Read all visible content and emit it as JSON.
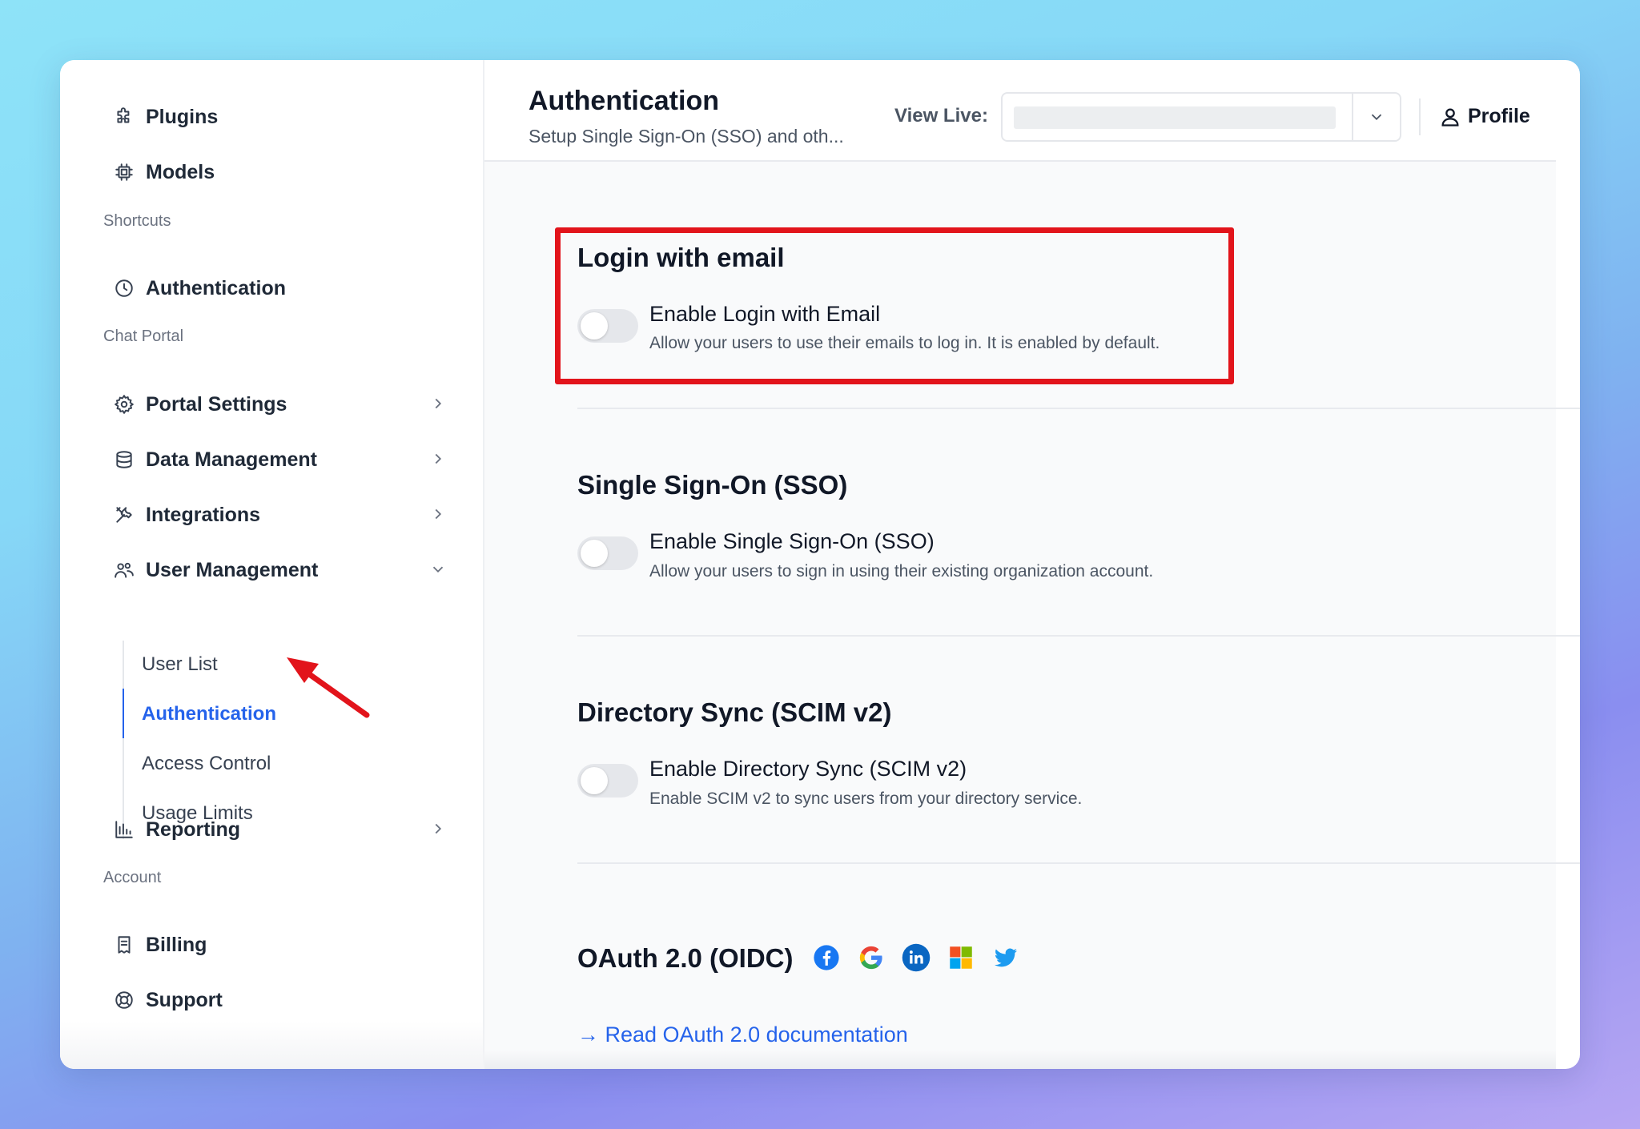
{
  "sidebar": {
    "top_items": [
      {
        "label": "Plugins",
        "icon": "puzzle-icon"
      },
      {
        "label": "Models",
        "icon": "chip-icon"
      }
    ],
    "shortcuts": {
      "heading": "Shortcuts",
      "items": [
        {
          "label": "Authentication",
          "icon": "clock-icon"
        }
      ]
    },
    "chat_portal": {
      "heading": "Chat Portal",
      "items": [
        {
          "label": "Portal Settings",
          "icon": "gear-icon"
        },
        {
          "label": "Data Management",
          "icon": "database-icon"
        },
        {
          "label": "Integrations",
          "icon": "tools-icon"
        },
        {
          "label": "User Management",
          "icon": "users-icon",
          "expanded": true
        }
      ],
      "user_management_sub": [
        "User List",
        "Authentication",
        "Access Control",
        "Usage Limits"
      ],
      "active_sub": "Authentication",
      "reporting": {
        "label": "Reporting",
        "icon": "bar-chart-icon"
      }
    },
    "account": {
      "heading": "Account",
      "items": [
        {
          "label": "Billing",
          "icon": "receipt-icon"
        },
        {
          "label": "Support",
          "icon": "lifebuoy-icon"
        }
      ]
    }
  },
  "header": {
    "title": "Authentication",
    "subtitle": "Setup Single Sign-On (SSO) and oth...",
    "view_live_label": "View Live:",
    "view_live_value": "",
    "profile_label": "Profile"
  },
  "sections": {
    "email": {
      "title": "Login with email",
      "option_title": "Enable Login with Email",
      "option_desc": "Allow your users to use their emails to log in. It is enabled by default.",
      "enabled": false
    },
    "sso": {
      "title": "Single Sign-On (SSO)",
      "option_title": "Enable Single Sign-On (SSO)",
      "option_desc": "Allow your users to sign in using their existing organization account.",
      "enabled": false
    },
    "scim": {
      "title": "Directory Sync (SCIM v2)",
      "option_title": "Enable Directory Sync (SCIM v2)",
      "option_desc": "Enable SCIM v2 to sync users from your directory service.",
      "enabled": false
    },
    "oauth": {
      "title": "OAuth 2.0 (OIDC)",
      "providers": [
        "facebook-icon",
        "google-icon",
        "linkedin-icon",
        "microsoft-icon",
        "twitter-icon"
      ],
      "link": "→ Read OAuth 2.0 documentation"
    }
  },
  "colors": {
    "accent": "#2563eb",
    "highlight": "#e2141b",
    "arrow": "#e2141b"
  }
}
